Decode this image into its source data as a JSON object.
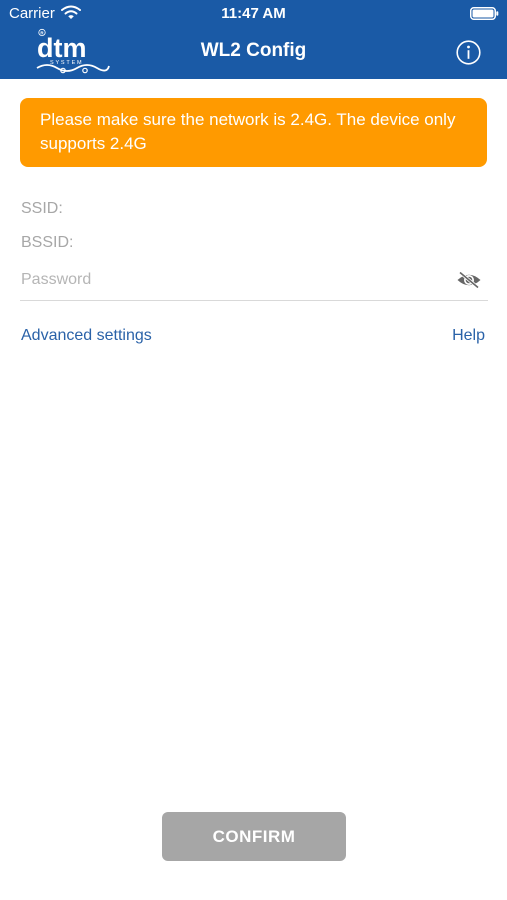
{
  "status_bar": {
    "carrier": "Carrier",
    "time": "11:47 AM",
    "icons": [
      "wifi-icon",
      "battery-icon"
    ]
  },
  "nav": {
    "title": "WL2 Config",
    "logo_text": "dtm",
    "logo_subtext": "SYSTEM",
    "info_icon": "info-icon"
  },
  "banner": {
    "text": "Please make sure the network is 2.4G. The device only supports 2.4G"
  },
  "form": {
    "ssid_label": "SSID:",
    "ssid_value": "",
    "bssid_label": "BSSID:",
    "bssid_value": "",
    "password_placeholder": "Password",
    "password_value": "",
    "eye_icon": "eye-slash-icon"
  },
  "links": {
    "advanced": "Advanced settings",
    "help": "Help"
  },
  "confirm_button": {
    "label": "CONFIRM"
  },
  "colors": {
    "header_blue": "#1a5aa6",
    "banner_orange": "#ff9a00",
    "link_blue": "#2a62a8",
    "button_gray": "#a6a6a6"
  }
}
